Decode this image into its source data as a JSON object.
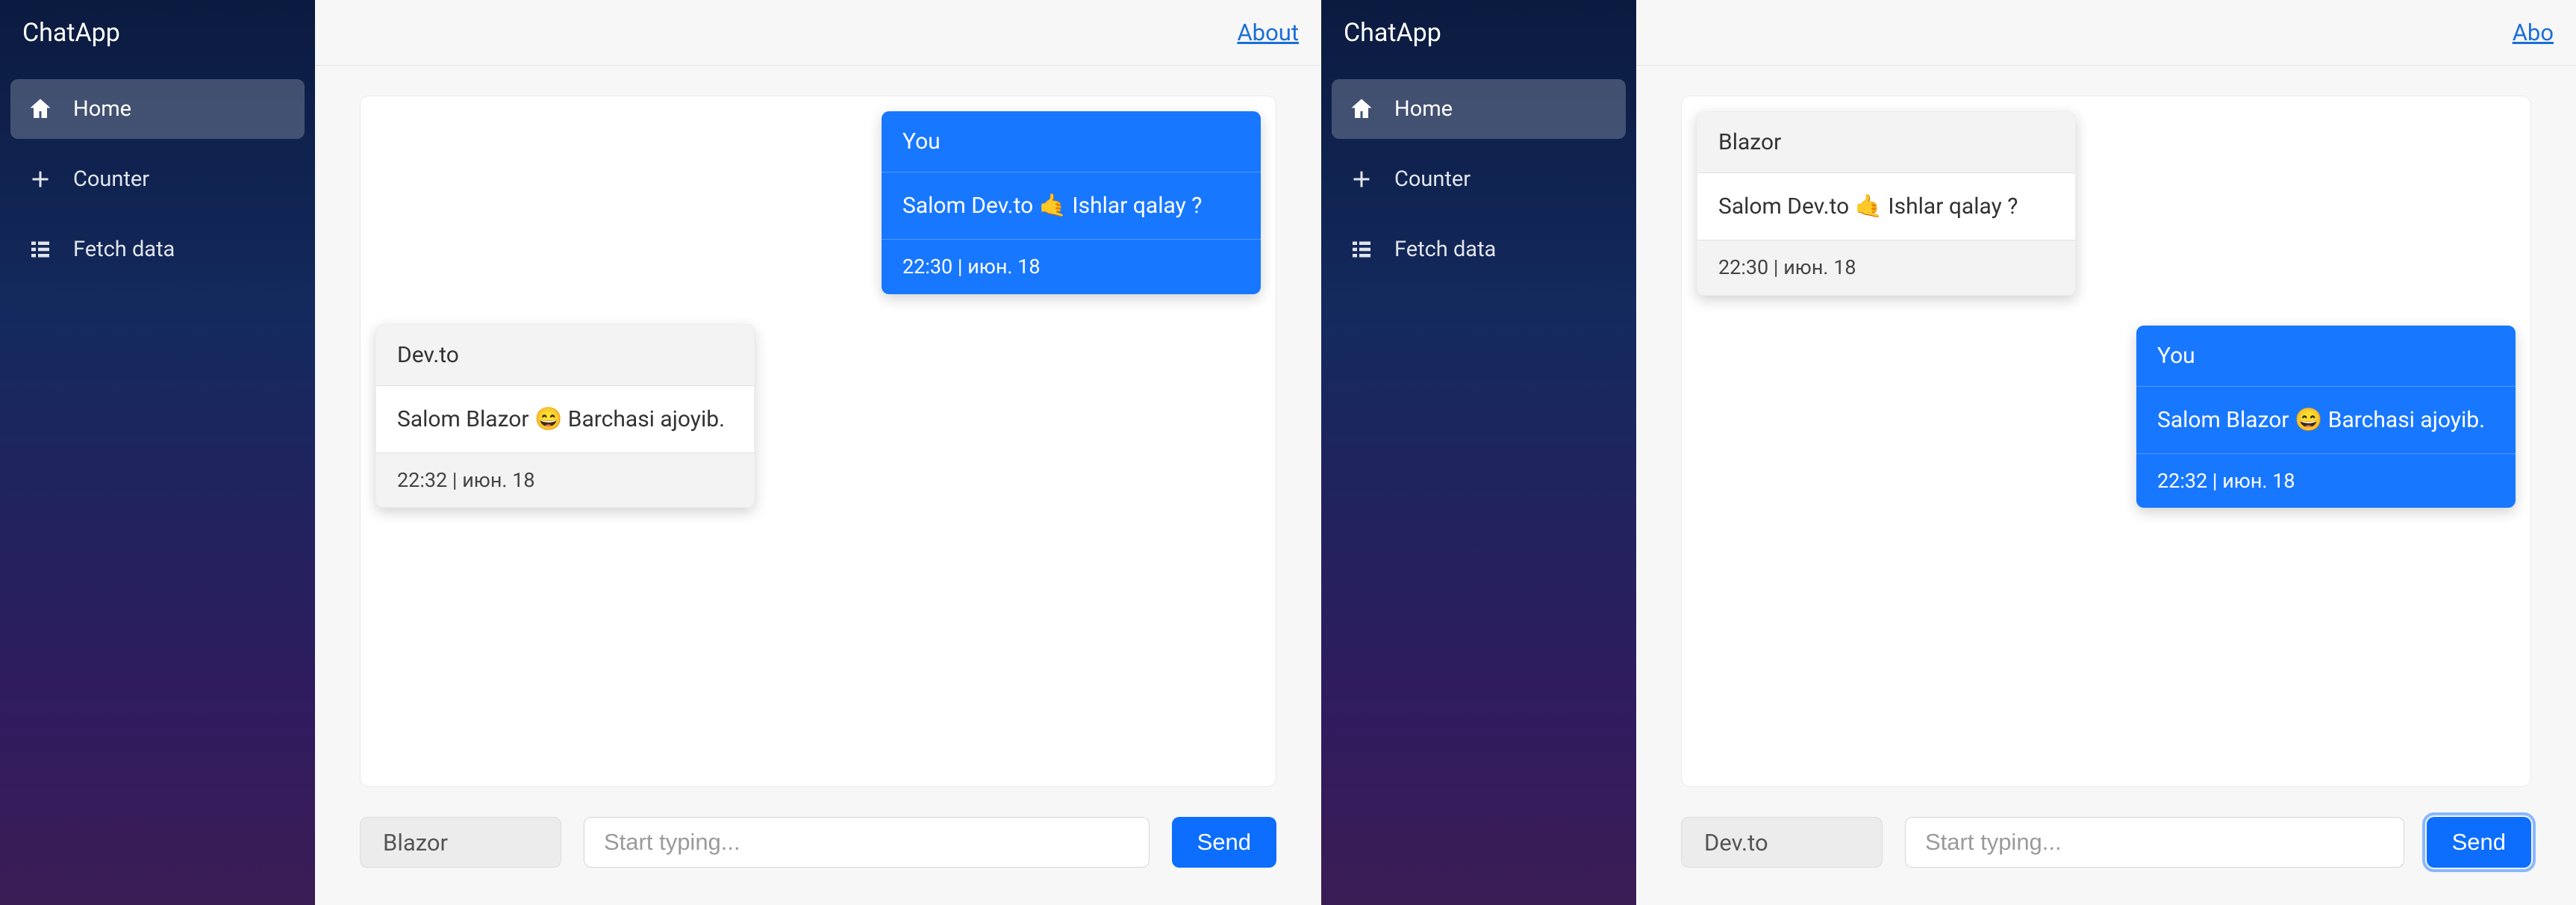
{
  "left": {
    "brand": "ChatApp",
    "about": "About",
    "nav": {
      "home": "Home",
      "counter": "Counter",
      "fetch": "Fetch data"
    },
    "messages": {
      "m0": {
        "sender": "You",
        "body": "Salom Dev.to 🤙 Ishlar qalay ?",
        "ts": "22:30 | июн. 18"
      },
      "m1": {
        "sender": "Dev.to",
        "body": "Salom Blazor 😄 Barchasi ajoyib.",
        "ts": "22:32 | июн. 18"
      }
    },
    "compose": {
      "user": "Blazor",
      "placeholder": "Start typing...",
      "send": "Send"
    }
  },
  "right": {
    "brand": "ChatApp",
    "about": "Abo",
    "nav": {
      "home": "Home",
      "counter": "Counter",
      "fetch": "Fetch data"
    },
    "messages": {
      "m0": {
        "sender": "Blazor",
        "body": "Salom Dev.to 🤙 Ishlar qalay ?",
        "ts": "22:30 | июн. 18"
      },
      "m1": {
        "sender": "You",
        "body": "Salom Blazor 😄 Barchasi ajoyib.",
        "ts": "22:32 | июн. 18"
      }
    },
    "compose": {
      "user": "Dev.to",
      "placeholder": "Start typing...",
      "send": "Send"
    }
  }
}
